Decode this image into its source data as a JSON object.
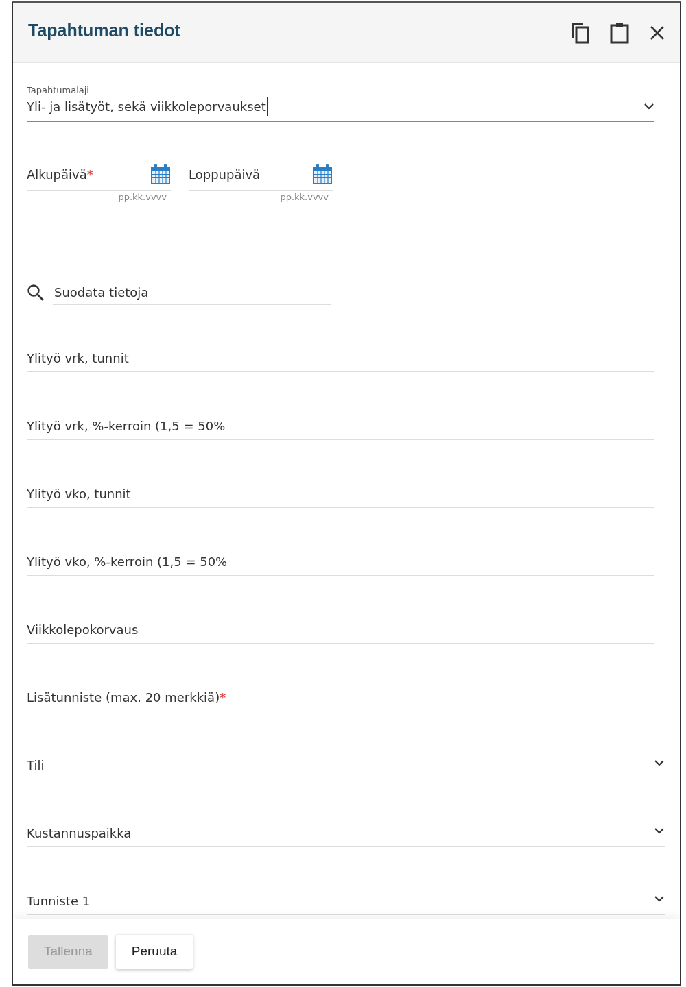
{
  "dialog": {
    "title": "Tapahtuman tiedot"
  },
  "event_type": {
    "label": "Tapahtumalaji",
    "value": "Yli- ja lisätyöt, sekä viikkoleporvaukset",
    "focused": true
  },
  "dates": [
    {
      "label": "Alkupäivä",
      "marker": "*",
      "hint": "pp.kk.vvvv"
    },
    {
      "label": "Loppupäivä",
      "hint": "pp.kk.vvvv"
    }
  ],
  "filter": {
    "placeholder": "Suodata tietoja"
  },
  "fields": [
    {
      "kind": "text",
      "label": "Ylityö vrk, tunnit"
    },
    {
      "kind": "text",
      "label": "Ylityö vrk, %-kerroin (1,5 = 50%"
    },
    {
      "kind": "text",
      "label": "Ylityö vko, tunnit"
    },
    {
      "kind": "text",
      "label": "Ylityö vko, %-kerroin (1,5 = 50%"
    },
    {
      "kind": "text",
      "label": "Viikkolepokorvaus"
    },
    {
      "kind": "text",
      "label": "Lisätunniste (max. 20 merkkiä)",
      "marker": "*"
    },
    {
      "kind": "select",
      "label": "Tili"
    },
    {
      "kind": "select",
      "label": "Kustannuspaikka"
    },
    {
      "kind": "select",
      "label": "Tunniste 1"
    }
  ],
  "buttons": [
    {
      "label": "Tallenna",
      "disabled": true
    },
    {
      "label": "Peruuta",
      "disabled": false
    }
  ]
}
